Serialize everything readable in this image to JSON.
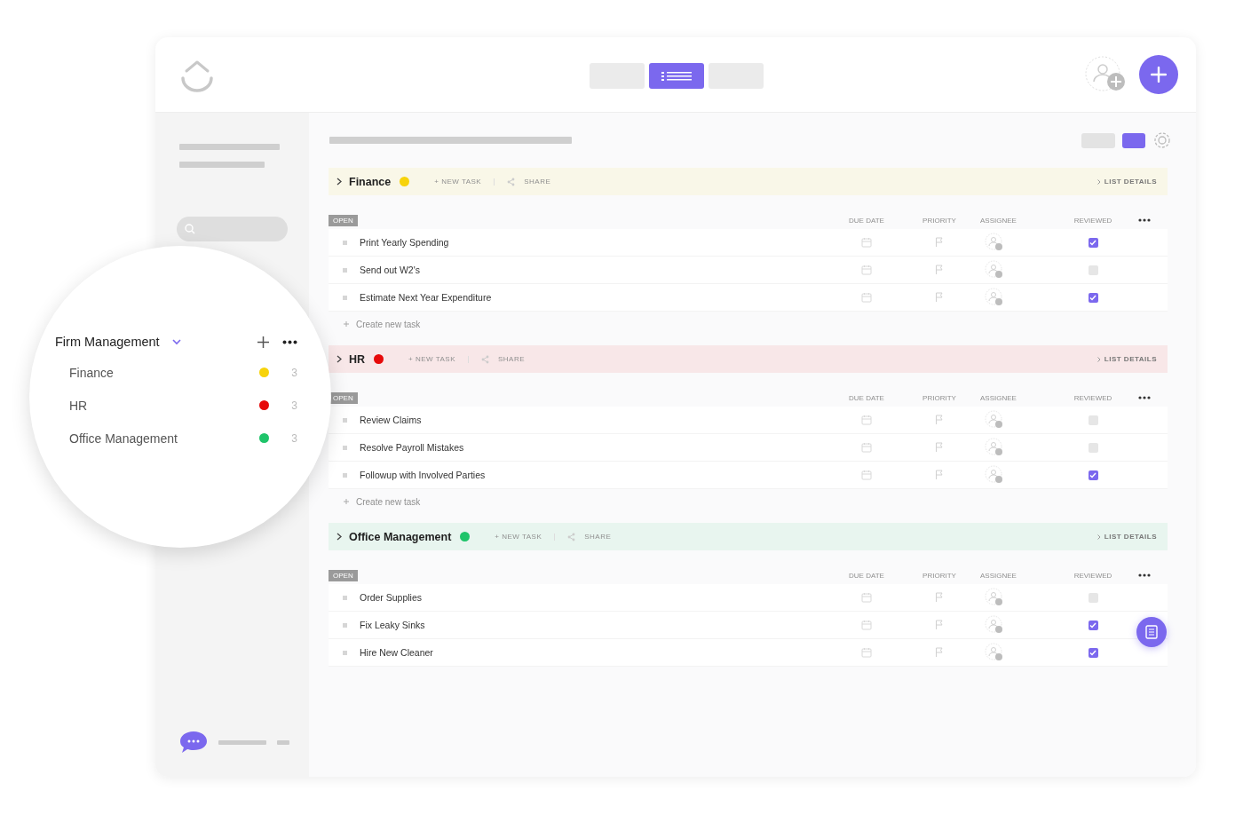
{
  "view_switcher": [
    {
      "selected": false
    },
    {
      "selected": true
    },
    {
      "selected": false
    }
  ],
  "layout_toggle": [
    {
      "selected": false
    },
    {
      "selected": true
    }
  ],
  "lists": [
    {
      "name": "Finance",
      "color": "#f7d30b",
      "new_task": "+ NEW TASK",
      "share": "SHARE",
      "details": "LIST DETAILS",
      "status": "OPEN",
      "columns": [
        "DUE DATE",
        "PRIORITY",
        "ASSIGNEE",
        "REVIEWED"
      ],
      "create_task": "Create new task",
      "tasks": [
        {
          "name": "Print Yearly Spending",
          "reviewed": true
        },
        {
          "name": "Send out W2's",
          "reviewed": false
        },
        {
          "name": "Estimate Next Year Expenditure",
          "reviewed": true
        }
      ]
    },
    {
      "name": "HR",
      "color": "#e60a0a",
      "new_task": "+ NEW TASK",
      "share": "SHARE",
      "details": "LIST DETAILS",
      "status": "OPEN",
      "columns": [
        "DUE DATE",
        "PRIORITY",
        "ASSIGNEE",
        "REVIEWED"
      ],
      "create_task": "Create new task",
      "tasks": [
        {
          "name": "Review Claims",
          "reviewed": false
        },
        {
          "name": "Resolve Payroll Mistakes",
          "reviewed": false
        },
        {
          "name": "Followup with Involved Parties",
          "reviewed": true
        }
      ]
    },
    {
      "name": "Office Management",
      "color": "#1fc46a",
      "new_task": "+ NEW TASK",
      "share": "SHARE",
      "details": "LIST DETAILS",
      "status": "OPEN",
      "columns": [
        "DUE DATE",
        "PRIORITY",
        "ASSIGNEE",
        "REVIEWED"
      ],
      "tasks": [
        {
          "name": "Order Supplies",
          "reviewed": false
        },
        {
          "name": "Fix Leaky Sinks",
          "reviewed": true
        },
        {
          "name": "Hire New Cleaner",
          "reviewed": true
        }
      ]
    }
  ],
  "folder": {
    "name": "Firm Management",
    "items": [
      {
        "name": "Finance",
        "color": "#f7d30b",
        "count": "3"
      },
      {
        "name": "HR",
        "color": "#e60a0a",
        "count": "3"
      },
      {
        "name": "Office Management",
        "color": "#1fc46a",
        "count": "3"
      }
    ]
  }
}
